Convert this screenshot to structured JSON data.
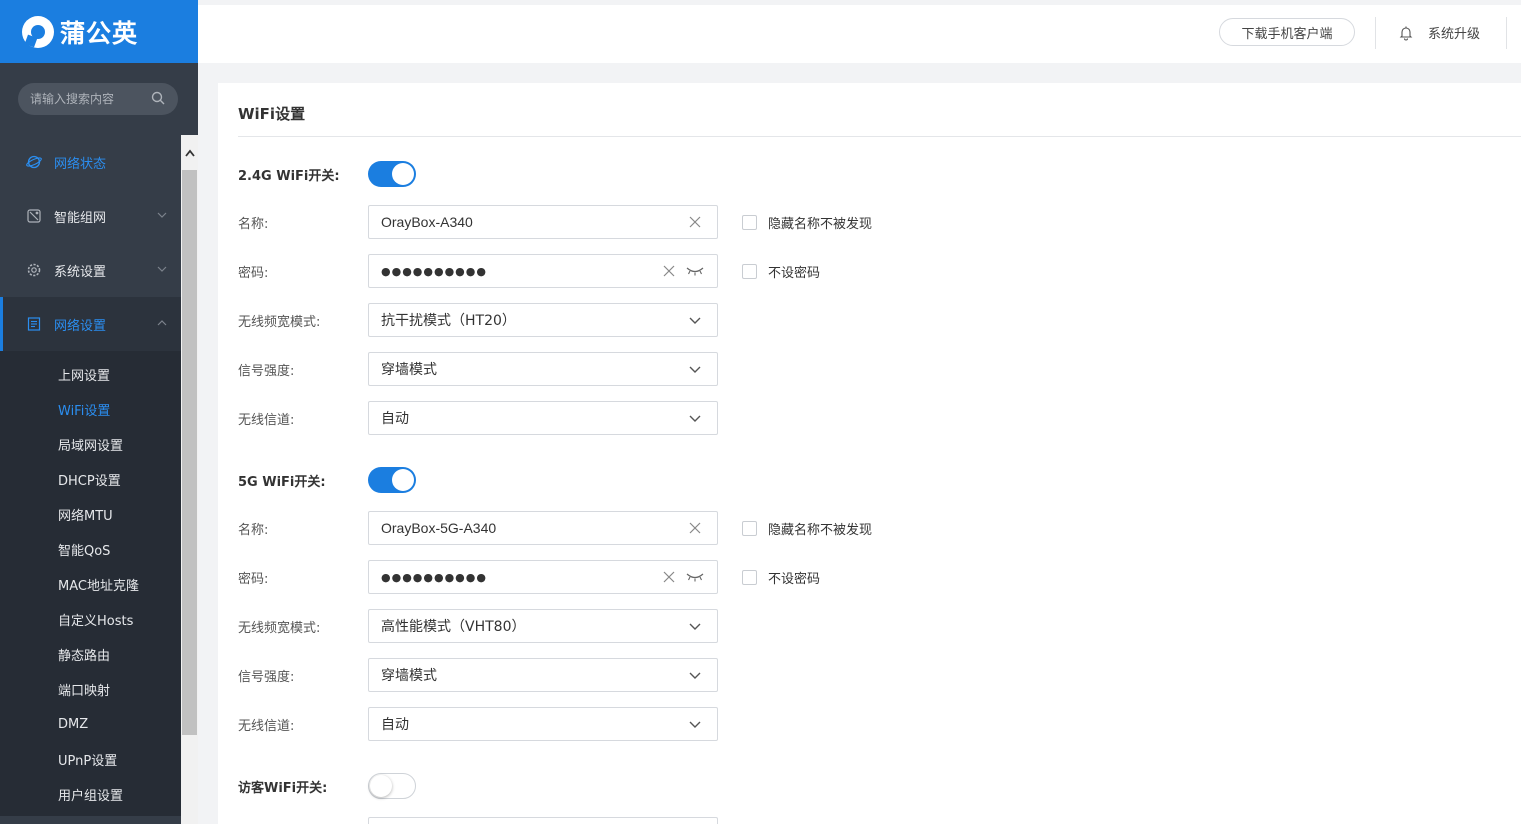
{
  "brand": {
    "name": "蒲公英",
    "color": "#1b7ee0"
  },
  "sidebar": {
    "search_placeholder": "请输入搜索内容",
    "items": [
      {
        "label": "网络状态",
        "icon": "planet-icon"
      },
      {
        "label": "智能组网",
        "icon": "network-icon"
      },
      {
        "label": "系统设置",
        "icon": "gear-icon"
      },
      {
        "label": "网络设置",
        "icon": "document-icon"
      }
    ],
    "submenu": [
      "上网设置",
      "WiFi设置",
      "局域网设置",
      "DHCP设置",
      "网络MTU",
      "智能QoS",
      "MAC地址克隆",
      "自定义Hosts",
      "静态路由",
      "端口映射",
      "DMZ",
      "UPnP设置",
      "用户组设置"
    ]
  },
  "header": {
    "download": "下载手机客户端",
    "upgrade": "系统升级"
  },
  "page": {
    "title": "WiFi设置",
    "wifi24": {
      "switch_label": "2.4G WiFi开关:",
      "enabled": true,
      "name_label": "名称:",
      "name_value": "OrayBox-A340",
      "hide_label": "隐藏名称不被发现",
      "pw_label": "密码:",
      "pw_value": "●●●●●●●●●●",
      "nopw_label": "不设密码",
      "bw_label": "无线频宽模式:",
      "bw_value": "抗干扰模式（HT20）",
      "signal_label": "信号强度:",
      "signal_value": "穿墙模式",
      "channel_label": "无线信道:",
      "channel_value": "自动"
    },
    "wifi5": {
      "switch_label": "5G WiFi开关:",
      "enabled": true,
      "name_label": "名称:",
      "name_value": "OrayBox-5G-A340",
      "hide_label": "隐藏名称不被发现",
      "pw_label": "密码:",
      "pw_value": "●●●●●●●●●●",
      "nopw_label": "不设密码",
      "bw_label": "无线频宽模式:",
      "bw_value": "高性能模式（VHT80）",
      "signal_label": "信号强度:",
      "signal_value": "穿墙模式",
      "channel_label": "无线信道:",
      "channel_value": "自动"
    },
    "guest": {
      "switch_label": "访客WiFi开关:",
      "enabled": false
    }
  }
}
